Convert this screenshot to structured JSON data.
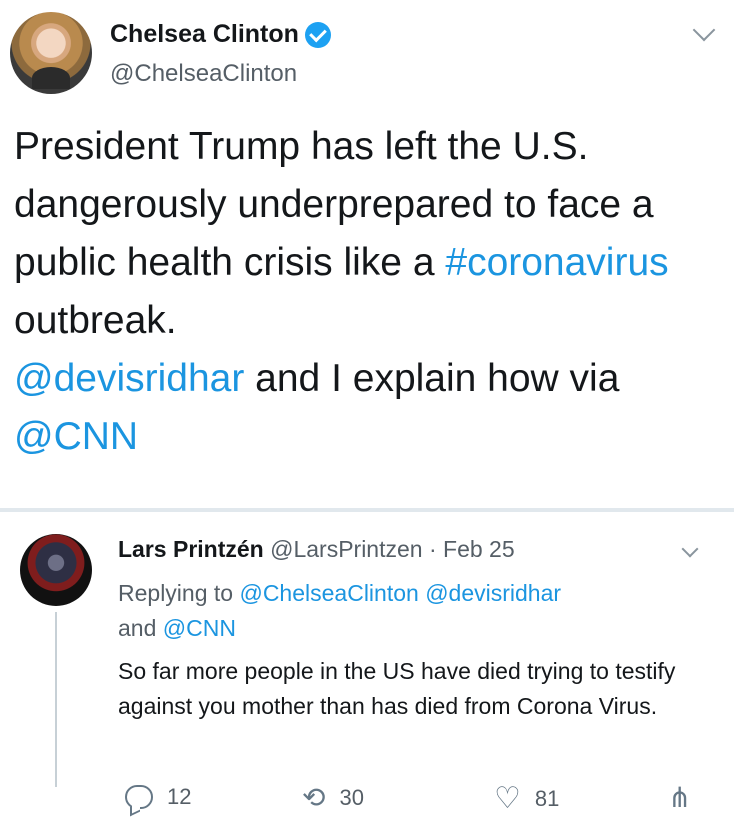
{
  "main_tweet": {
    "author_name": "Chelsea Clinton",
    "handle": "@ChelseaClinton",
    "text_part1": "President Trump has left the U.S. dangerously underprepared to face a public health crisis like a ",
    "hashtag": "#coronavirus",
    "text_part2": " outbreak. ",
    "mention1": "@devisridhar",
    "text_part3": " and I explain how via ",
    "mention2": "@CNN"
  },
  "reply_tweet": {
    "author_name": "Lars Printzén",
    "handle": "@LarsPrintzen",
    "separator": " · ",
    "date": "Feb 25",
    "replying_prefix": "Replying to ",
    "replying_mention1": "@ChelseaClinton",
    "replying_mention2": "@devisridhar",
    "replying_and": "and ",
    "replying_mention3": "@CNN",
    "text": "So far more people in the US have died trying to testify against you mother than has died from Corona Virus.",
    "actions": {
      "comments": "12",
      "retweets": "30",
      "likes": "81"
    }
  },
  "colors": {
    "link": "#1b95e0",
    "text": "#14171a",
    "muted": "#555e66",
    "verified": "#1da1f2"
  },
  "icons": [
    "verified-icon",
    "chevron-down-icon",
    "comment-icon",
    "retweet-icon",
    "heart-icon",
    "share-icon"
  ]
}
